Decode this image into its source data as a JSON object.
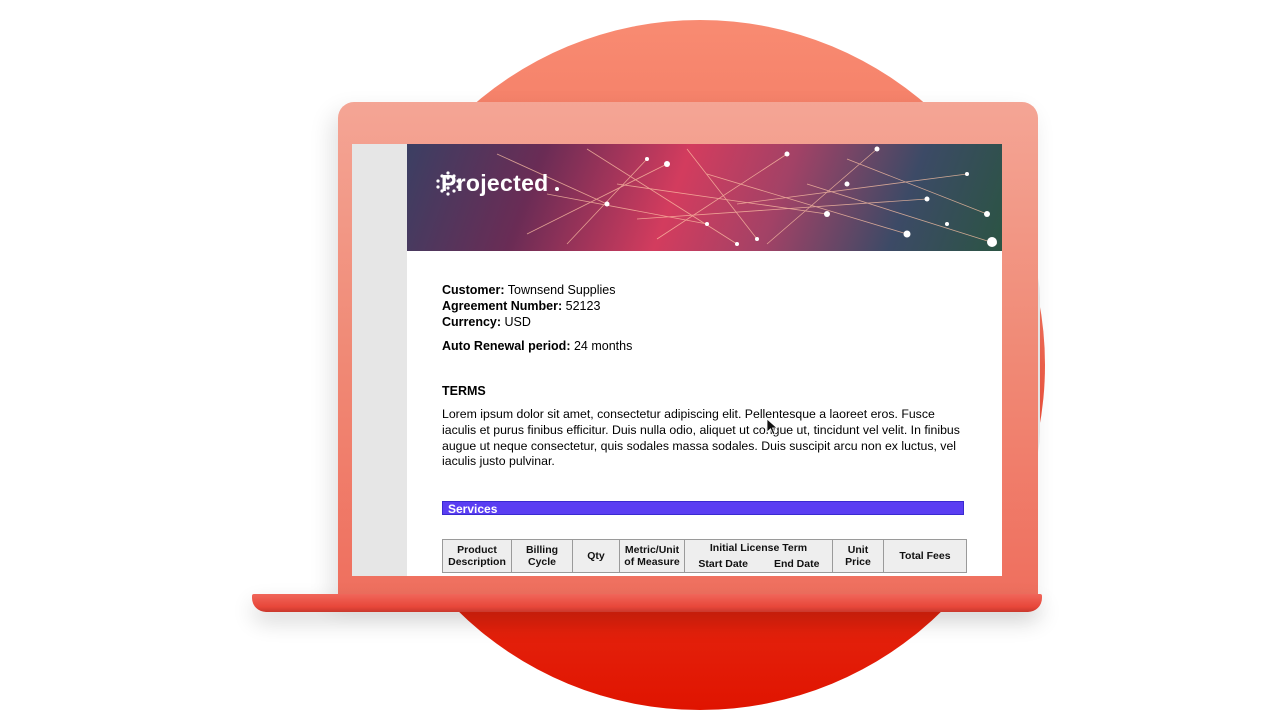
{
  "brand": {
    "logo_text": "Projected"
  },
  "agreement": {
    "customer_label": "Customer:",
    "customer_value": "Townsend Supplies",
    "number_label": "Agreement Number:",
    "number_value": "52123",
    "currency_label": "Currency:",
    "currency_value": "USD",
    "renewal_label": "Auto Renewal period:",
    "renewal_value": "24 months"
  },
  "terms": {
    "title": "TERMS",
    "body": "Lorem ipsum dolor sit amet, consectetur adipiscing elit. Pellentesque a laoreet eros. Fusce iaculis et purus finibus efficitur. Duis nulla odio, aliquet ut congue ut, tincidunt vel velit. In finibus augue ut neque consectetur, quis sodales massa sodales. Duis suscipit arcu non ex luctus, vel iaculis justo pulvinar."
  },
  "services": {
    "title": "Services",
    "columns": {
      "product": "Product Description",
      "billing": "Billing Cycle",
      "qty": "Qty",
      "metric": "Metric/Unit of Measure",
      "term": "Initial License Term",
      "start": "Start Date",
      "end": "End Date",
      "price": "Unit Price",
      "fees": "Total Fees"
    }
  },
  "colors": {
    "services_bar": "#5a3ef2",
    "laptop": "#ef6f5e",
    "circle_bottom": "#e01400"
  }
}
